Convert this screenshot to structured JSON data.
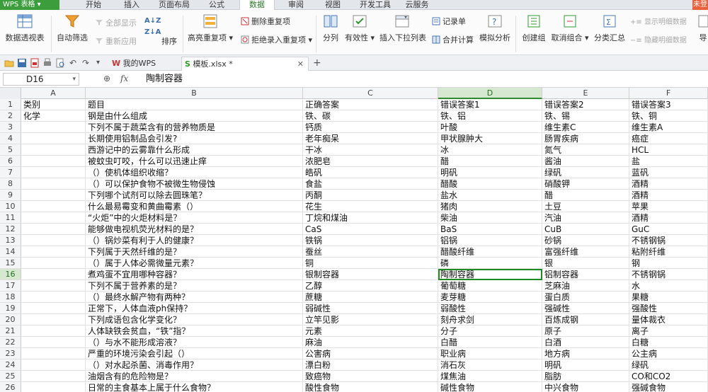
{
  "app": {
    "name": "WPS 表格",
    "login": "未登"
  },
  "menu_tabs": [
    {
      "label": "开始",
      "active": false
    },
    {
      "label": "插入",
      "active": false
    },
    {
      "label": "页面布局",
      "active": false
    },
    {
      "label": "公式",
      "active": false
    },
    {
      "label": "数据",
      "active": true
    },
    {
      "label": "审阅",
      "active": false
    },
    {
      "label": "视图",
      "active": false
    },
    {
      "label": "开发工具",
      "active": false
    },
    {
      "label": "云服务",
      "active": false
    }
  ],
  "ribbon": {
    "pivot": "数据透视表",
    "autofilter": "自动筛选",
    "show_all": "全部显示",
    "reapply": "重新应用",
    "sort": "排序",
    "highlight_dup": "高亮重复项",
    "remove_dup": "删除重复项",
    "reject_dup": "拒绝录入重复项",
    "split": "分列",
    "validity": "有效性",
    "dropdown": "插入下拉列表",
    "record": "记录单",
    "merge_calc": "合并计算",
    "simulate": "模拟分析",
    "create_group": "创建组",
    "ungroup": "取消组合",
    "subtotal": "分类汇总",
    "show_detail": "显示明细数据",
    "hide_detail": "隐藏明细数据",
    "import": "导"
  },
  "doc_tabs": [
    {
      "label": "我的WPS",
      "active": false
    },
    {
      "label": "模板.xlsx *",
      "active": true
    }
  ],
  "formula_bar": {
    "name_box": "D16",
    "fx": "fx",
    "value": "陶制容器"
  },
  "columns": [
    "A",
    "B",
    "C",
    "D",
    "E",
    "F"
  ],
  "selected_col": "D",
  "selected_row": 16,
  "rows": [
    {
      "n": "1",
      "cells": [
        "类别",
        "题目",
        "正确答案",
        "错误答案1",
        "错误答案2",
        "错误答案3"
      ]
    },
    {
      "n": "2",
      "cells": [
        "化学",
        "钢是由什么组成",
        "铁、碳",
        "铁、铝",
        "铁、锡",
        "铁、铜"
      ]
    },
    {
      "n": "3",
      "cells": [
        "",
        "下列不属于蔬菜含有的营养物质是",
        "钙质",
        "叶酸",
        "维生素C",
        "维生素A"
      ]
    },
    {
      "n": "4",
      "cells": [
        "",
        "长期使用铝制品会引发?",
        "老年痴呆",
        "甲状腺肿大",
        "肠胃疾病",
        "癌症"
      ]
    },
    {
      "n": "5",
      "cells": [
        "",
        "西游记中的云雾靠什么形成",
        "干冰",
        "冰",
        "氮气",
        "HCL"
      ]
    },
    {
      "n": "6",
      "cells": [
        "",
        "被蚊虫叮咬，什么可以迅速止痒",
        "浓肥皂",
        "醋",
        "酱油",
        "盐"
      ]
    },
    {
      "n": "7",
      "cells": [
        "",
        "（）使机体组织收缩？",
        "皓矾",
        "明矾",
        "绿矾",
        "蓝矾"
      ]
    },
    {
      "n": "8",
      "cells": [
        "",
        "（）可以保护食物不被微生物侵蚀",
        "食盐",
        "醋酸",
        "硝酸钾",
        "酒精"
      ]
    },
    {
      "n": "9",
      "cells": [
        "",
        "下列哪个试剂可以除去圆珠笔？",
        "丙酮",
        "盐水",
        "醋",
        "酒精"
      ]
    },
    {
      "n": "10",
      "cells": [
        "",
        "什么最易霉变和黄曲霉素（）",
        "花生",
        "猪肉",
        "土豆",
        "苹果"
      ]
    },
    {
      "n": "11",
      "cells": [
        "",
        "“火炬”中的火炬材料是？",
        "丁烷和煤油",
        "柴油",
        "汽油",
        "酒精"
      ]
    },
    {
      "n": "12",
      "cells": [
        "",
        "能够做电视机荧光材料的是？",
        "CaS",
        "BaS",
        "CuB",
        "GuC"
      ]
    },
    {
      "n": "13",
      "cells": [
        "",
        "（）锅炒菜有利于人的健康？",
        "铁锅",
        "铝锅",
        "砂锅",
        "不锈钢锅"
      ]
    },
    {
      "n": "14",
      "cells": [
        "",
        "下列属于天然纤维的是？",
        "蚕丝",
        "醋酸纤维",
        "富强纤维",
        "粘附纤维"
      ]
    },
    {
      "n": "15",
      "cells": [
        "",
        "（）属于人体必需微量元素？",
        "铜",
        "磷",
        "银",
        "钢"
      ]
    },
    {
      "n": "16",
      "cells": [
        "",
        "煮鸡蛋不宜用哪种容器？",
        "银制容器",
        "陶制容器",
        "铝制容器",
        "不锈钢锅"
      ]
    },
    {
      "n": "17",
      "cells": [
        "",
        "下列不属于营养素的是？",
        "乙醇",
        "葡萄糖",
        "芝麻油",
        "水"
      ]
    },
    {
      "n": "18",
      "cells": [
        "",
        "（）最终水解产物有两种？",
        "蔗糖",
        "麦芽糖",
        "蛋白质",
        "果糖"
      ]
    },
    {
      "n": "19",
      "cells": [
        "",
        "正常下，人体血液ph保持？",
        "弱碱性",
        "弱酸性",
        "强碱性",
        "强酸性"
      ]
    },
    {
      "n": "20",
      "cells": [
        "",
        "下列成语包含化学变化？",
        "立竿见影",
        "刻舟求剑",
        "百炼成钢",
        "量体裁衣"
      ]
    },
    {
      "n": "21",
      "cells": [
        "",
        "人体缺铁会贫血，“铁”指？",
        "元素",
        "分子",
        "原子",
        "离子"
      ]
    },
    {
      "n": "22",
      "cells": [
        "",
        "（）与水不能形成溶液？",
        "麻油",
        "白醋",
        "白酒",
        "白糖"
      ]
    },
    {
      "n": "23",
      "cells": [
        "",
        "严重的环境污染会引起（）",
        "公害病",
        "职业病",
        "地方病",
        "公主病"
      ]
    },
    {
      "n": "24",
      "cells": [
        "",
        "（）对水起杀菌、消毒作用？",
        "漂白粉",
        "消石灰",
        "明矾",
        "绿矾"
      ]
    },
    {
      "n": "25",
      "cells": [
        "",
        "油烟含有的危险物是？",
        "致癌物",
        "煤焦油",
        "脂肪",
        "CO和CO2"
      ]
    },
    {
      "n": "26",
      "cells": [
        "",
        "日常的主食基本上属于什么食物？",
        "酸性食物",
        "碱性食物",
        "中兴食物",
        "强碱食物"
      ]
    }
  ]
}
